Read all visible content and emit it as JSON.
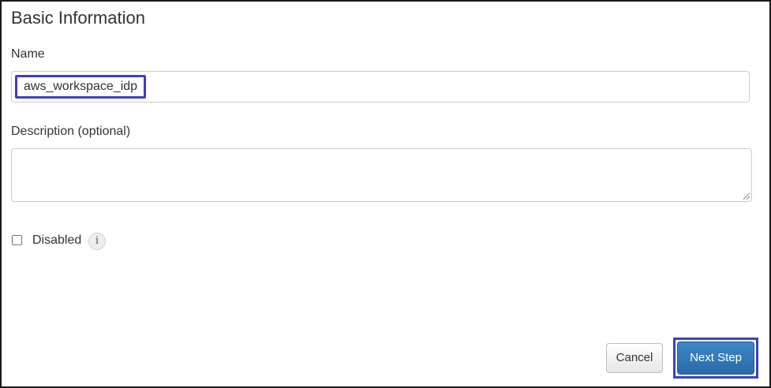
{
  "section": {
    "title": "Basic Information"
  },
  "fields": {
    "name": {
      "label": "Name",
      "value": "aws_workspace_idp"
    },
    "description": {
      "label": "Description (optional)",
      "value": ""
    },
    "disabled": {
      "label": "Disabled",
      "checked": false,
      "info_icon": "info-icon"
    }
  },
  "actions": {
    "cancel_label": "Cancel",
    "next_label": "Next Step"
  },
  "colors": {
    "primary_button": "#2f74b5",
    "highlight_outline": "#3a3fc4",
    "text": "#333333"
  }
}
